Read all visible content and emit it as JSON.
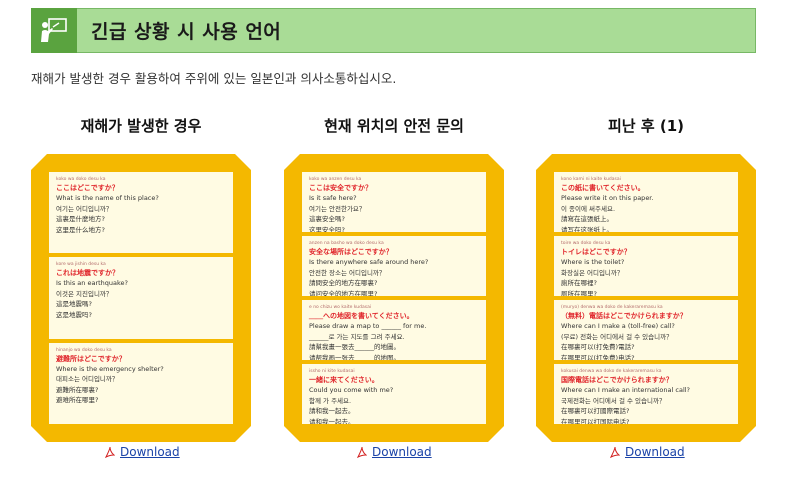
{
  "header": {
    "title": "긴급 상황 시 사용 언어",
    "icon": "presenter-icon",
    "bg_color": "#a9dc96",
    "icon_bg_color": "#5aa33f"
  },
  "intro": "재해가 발생한 경우 활용하여 주위에 있는 일본인과 의사소통하십시오.",
  "accent_color": "#f4b800",
  "columns": [
    {
      "title": "재해가 발생한 경우",
      "download_label": "Download",
      "phrases": [
        {
          "roman": "koko wa doko desu ka",
          "jp": "ここはどこですか？",
          "lines": [
            "What is the name of this place?",
            "여기는 어디입니까？",
            "這裏是什麼地方?",
            "这里是什么地方?"
          ]
        },
        {
          "roman": "kore wa jishin desu ka",
          "jp": "これは地震ですか？",
          "lines": [
            "Is this an earthquake?",
            "이것은 지진입니까？",
            "這是地震嗎?",
            "这是地震吗?"
          ]
        },
        {
          "roman": "hinanjo wa doko desu ka",
          "jp": "避難所はどこですか？",
          "lines": [
            "Where is the emergency shelter?",
            "대피소는 어디입니까？",
            "避難所在哪裏?",
            "避难所在哪里?"
          ]
        }
      ]
    },
    {
      "title": "현재 위치의 안전 문의",
      "download_label": "Download",
      "phrases": [
        {
          "roman": "koko wa anzen desu ka",
          "jp": "ここは安全ですか？",
          "lines": [
            "Is it safe here?",
            "여기는 안전한가요？",
            "這裏安全嗎?",
            "这里安全吗?"
          ]
        },
        {
          "roman": "anzen na basho wa doko desu ka",
          "jp": "安全な場所はどこですか？",
          "lines": [
            "Is there anywhere safe around here?",
            "안전한 장소는 어디입니까？",
            "請問安全的地方在哪裏?",
            "请问安全的地方在哪里?"
          ]
        },
        {
          "roman": "e no chizu wo kaite kudasai",
          "jp": "＿＿への地図を書いてください。",
          "lines": [
            "Please draw a map to ______ for me.",
            "______로 가는 지도를 그려 주세요.",
            "請幫我畫一張去______的地圖。",
            "请帮我画一张去______的地图。"
          ]
        },
        {
          "roman": "issho ni kite kudasai",
          "jp": "一緒に来てください。",
          "lines": [
            "Could you come with me?",
            "함께 가 주세요.",
            "請和我一起去。",
            "请和我一起去。"
          ]
        }
      ]
    },
    {
      "title": "피난 후 (1)",
      "download_label": "Download",
      "phrases": [
        {
          "roman": "kono kami ni kaite kudasai",
          "jp": "この紙に書いてください。",
          "lines": [
            "Please write it on this paper.",
            "이 종이에 써주세요.",
            "請寫在這張紙上。",
            "请写在这张纸上。"
          ]
        },
        {
          "roman": "toire wa doko desu ka",
          "jp": "トイレはどこですか？",
          "lines": [
            "Where is the toilet?",
            "화장실은 어디입니까？",
            "廁所在哪裡?",
            "厕所在哪里?"
          ]
        },
        {
          "roman": "(muryo) denwa wa doko de kakeraremasu ka",
          "jp": "（無料）電話はどこでかけられますか？",
          "lines": [
            "Where can I make a (toll-free) call?",
            "(무료) 전화는 어디에서 걸 수 있습니까？",
            "在哪裏可以(打免費)電話?",
            "在哪里可以(打免费)电话?"
          ]
        },
        {
          "roman": "kokusai denwa wa doko de kakeraremasu ka",
          "jp": "国際電話はどこでかけられますか？",
          "lines": [
            "Where can I make an international call?",
            "국제전화는 어디에서 걸 수 있습니까？",
            "在哪裏可以打國際電話?",
            "在哪里可以打国际电话?"
          ]
        }
      ]
    }
  ]
}
